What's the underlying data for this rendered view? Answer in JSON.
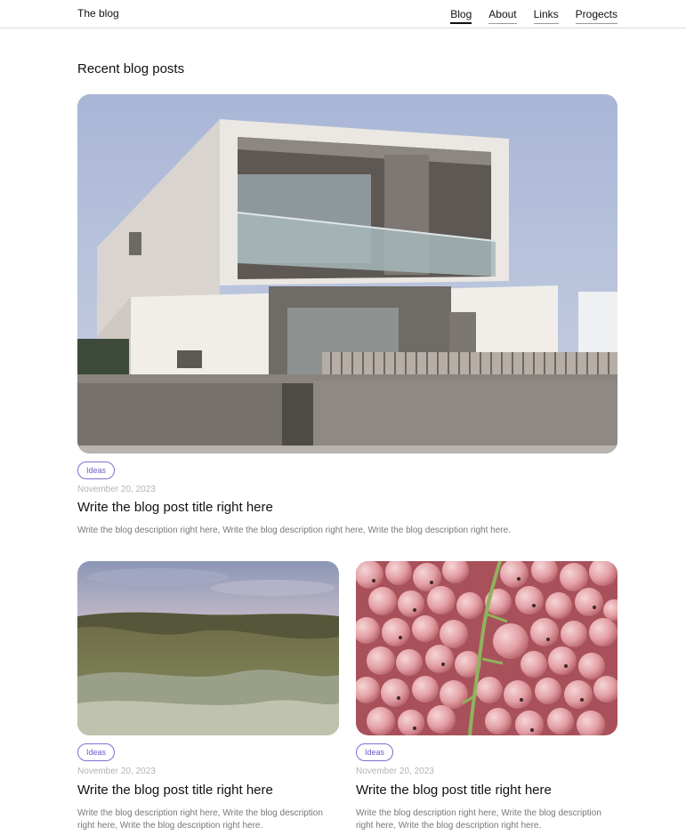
{
  "header": {
    "brand": "The blog",
    "nav": [
      {
        "label": "Blog",
        "active": true
      },
      {
        "label": "About",
        "active": false
      },
      {
        "label": "Links",
        "active": false
      },
      {
        "label": "Progects",
        "active": false
      }
    ]
  },
  "section_title": "Recent blog posts",
  "posts": [
    {
      "image": "modern-house-photo",
      "tag": "Ideas",
      "date": "November 20, 2023",
      "title": "Write the blog post title right here",
      "description": "Write the blog description right here, Write the blog description right here, Write the blog description right here."
    },
    {
      "image": "grassy-dunes-photo",
      "tag": "Ideas",
      "date": "November 20, 2023",
      "title": "Write the blog post title right here",
      "description": "Write the blog description right here, Write the blog description right here, Write the blog description right here."
    },
    {
      "image": "pink-currants-photo",
      "tag": "Ideas",
      "date": "November 20, 2023",
      "title": "Write the blog post title right here",
      "description": "Write the blog description right here, Write the blog description right here, Write the blog description right here."
    }
  ],
  "colors": {
    "accent": "#6a5cc7",
    "text": "#111111",
    "muted": "#777777",
    "date": "#b3b3b3",
    "divider": "#d9d9d9"
  }
}
